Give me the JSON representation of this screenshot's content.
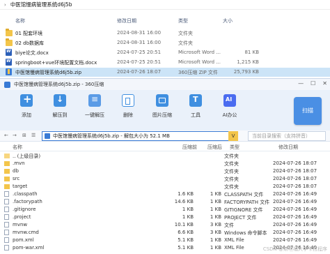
{
  "explorer": {
    "path": "中医馆慢病管理系统d6j5b",
    "columns": {
      "name": "名称",
      "date": "修改日期",
      "type": "类型",
      "size": "大小"
    },
    "rows": [
      {
        "name": "01 配套环境",
        "date": "2024-08-31 16:00",
        "type": "文件夹",
        "size": "",
        "icon": "folder"
      },
      {
        "name": "02 db数据库",
        "date": "2024-08-31 16:00",
        "type": "文件夹",
        "size": "",
        "icon": "folder"
      },
      {
        "name": "biye论文.docx",
        "date": "2024-07-25 20:51",
        "type": "Microsoft Word ...",
        "size": "81 KB",
        "icon": "docx"
      },
      {
        "name": "springboot+vue环境配置文档.docx",
        "date": "2024-07-25 20:51",
        "type": "Microsoft Word ...",
        "size": "1,215 KB",
        "icon": "docx"
      },
      {
        "name": "中医馆慢病管理系统d6j5b.zip",
        "date": "2024-07-26 18:07",
        "type": "360压缩 ZIP 文件",
        "size": "25,793 KB",
        "icon": "zip"
      }
    ]
  },
  "zip": {
    "title": "中医馆慢病管理系统d6j5b.zip - 360压缩",
    "window_buttons": {
      "minimize": "—",
      "maximize": "☐",
      "close": "✕"
    },
    "toolbar": [
      {
        "label": "添加",
        "icon": "add-icon"
      },
      {
        "label": "解压到",
        "icon": "extract-icon"
      },
      {
        "label": "一键解压",
        "icon": "one-click-extract-icon"
      },
      {
        "label": "删除",
        "icon": "delete-icon"
      },
      {
        "label": "图片压缩",
        "icon": "image-compress-icon"
      },
      {
        "label": "工具",
        "icon": "tools-icon"
      },
      {
        "label": "AI办公",
        "icon": "ai-icon"
      }
    ],
    "scan_label": "扫描",
    "nav": {
      "back": "←",
      "forward": "→",
      "view": "⊞",
      "list": "☰"
    },
    "address": "中医馆慢病管理系统d6j5b.zip - 解包大小为 52.1 MB",
    "address_dropdown": "V",
    "search_placeholder": "当前目录搜索（支持拼音）",
    "columns": {
      "name": "名称",
      "size": "压缩前",
      "compressed": "压缩后",
      "type": "类型",
      "date": "修改日期"
    },
    "rows": [
      {
        "name": ".. (上级目录)",
        "size": "",
        "compressed": "",
        "type": "文件夹",
        "date": "",
        "icon": "up"
      },
      {
        "name": ".mvn",
        "size": "",
        "compressed": "",
        "type": "文件夹",
        "date": "2024-07-26 18:07",
        "icon": "folder"
      },
      {
        "name": "db",
        "size": "",
        "compressed": "",
        "type": "文件夹",
        "date": "2024-07-26 18:07",
        "icon": "folder"
      },
      {
        "name": "src",
        "size": "",
        "compressed": "",
        "type": "文件夹",
        "date": "2024-07-26 18:07",
        "icon": "folder"
      },
      {
        "name": "target",
        "size": "",
        "compressed": "",
        "type": "文件夹",
        "date": "2024-07-26 18:07",
        "icon": "folder"
      },
      {
        "name": ".classpath",
        "size": "1.6 KB",
        "compressed": "1 KB",
        "type": "CLASSPATH 文件",
        "date": "2024-07-26 16:49",
        "icon": "file"
      },
      {
        "name": ".factorypath",
        "size": "14.6 KB",
        "compressed": "1 KB",
        "type": "FACTORYPATH 文件",
        "date": "2024-07-26 16:49",
        "icon": "file"
      },
      {
        "name": ".gitignore",
        "size": "1 KB",
        "compressed": "1 KB",
        "type": "GITIGNORE 文件",
        "date": "2024-07-26 16:49",
        "icon": "file"
      },
      {
        "name": ".project",
        "size": "1 KB",
        "compressed": "1 KB",
        "type": "PROJECT 文件",
        "date": "2024-07-26 16:49",
        "icon": "file"
      },
      {
        "name": "mvnw",
        "size": "10.1 KB",
        "compressed": "3 KB",
        "type": "文件",
        "date": "2024-07-26 16:49",
        "icon": "file"
      },
      {
        "name": "mvnw.cmd",
        "size": "6.6 KB",
        "compressed": "3 KB",
        "type": "Windows 命令脚本",
        "date": "2024-07-26 16:49",
        "icon": "file"
      },
      {
        "name": "pom.xml",
        "size": "5.1 KB",
        "compressed": "1 KB",
        "type": "XML File",
        "date": "2024-07-26 16:49",
        "icon": "file"
      },
      {
        "name": "pom-war.xml",
        "size": "5.1 KB",
        "compressed": "1 KB",
        "type": "XML File",
        "date": "2024-07-26 16:49",
        "icon": "file"
      }
    ]
  },
  "watermark": "CSDN @斯坦福大学卡拉程序"
}
